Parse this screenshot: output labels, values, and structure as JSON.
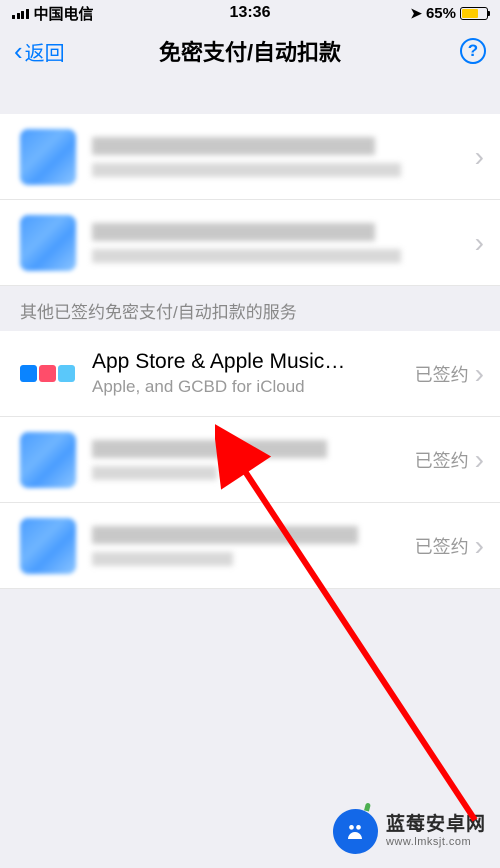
{
  "status_bar": {
    "carrier": "中国电信",
    "time": "13:36",
    "battery_percent": "65%"
  },
  "nav": {
    "back_label": "返回",
    "title": "免密支付/自动扣款",
    "help_label": "?"
  },
  "section2_header": "其他已签约免密支付/自动扣款的服务",
  "items": {
    "apple": {
      "title": "App Store & Apple Music…",
      "subtitle": "Apple, and GCBD for iCloud",
      "status": "已签约"
    },
    "signed_status": "已签约"
  },
  "watermark": {
    "line1": "蓝莓安卓网",
    "line2": "www.lmksjt.com"
  }
}
